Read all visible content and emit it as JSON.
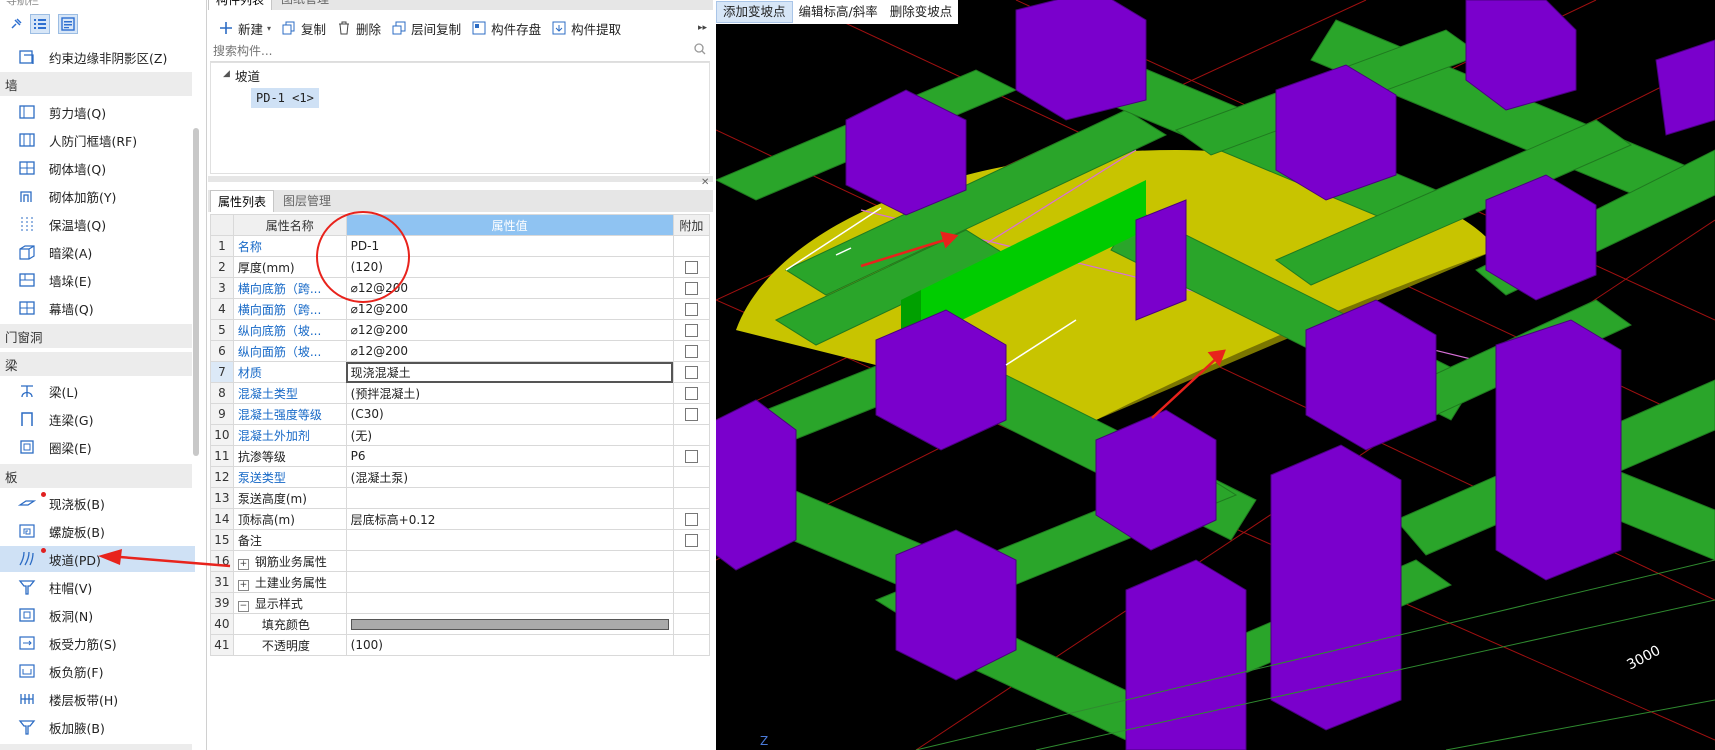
{
  "nav": {
    "title": "导航栏",
    "top_item": "约束边缘非阴影区(Z)",
    "categories": {
      "wall": "墙",
      "door_window": "门窗洞",
      "beam": "梁",
      "slab": "板"
    },
    "wall_items": [
      "剪力墙(Q)",
      "人防门框墙(RF)",
      "砌体墙(Q)",
      "砌体加筋(Y)",
      "保温墙(Q)",
      "暗梁(A)",
      "墙垛(E)",
      "幕墙(Q)"
    ],
    "beam_items": [
      "梁(L)",
      "连梁(G)",
      "圈梁(E)"
    ],
    "slab_items": [
      "现浇板(B)",
      "螺旋板(B)",
      "坡道(PD)",
      "柱帽(V)",
      "板洞(N)",
      "板受力筋(S)",
      "板负筋(F)",
      "楼层板带(H)",
      "板加腋(B)"
    ]
  },
  "component_list": {
    "tabs": [
      "构件列表",
      "图纸管理"
    ],
    "toolbar": {
      "new": "新建",
      "copy": "复制",
      "delete": "删除",
      "floor_copy": "层间复制",
      "save": "构件存盘",
      "extract": "构件提取"
    },
    "search_placeholder": "搜索构件...",
    "tree_root": "坡道",
    "tree_child": "PD-1 <1>"
  },
  "properties": {
    "tabs": [
      "属性列表",
      "图层管理"
    ],
    "headers": {
      "name": "属性名称",
      "value": "属性值",
      "extra": "附加"
    },
    "rows": [
      {
        "n": "1",
        "name": "名称",
        "value": "PD-1"
      },
      {
        "n": "2",
        "name": "厚度(mm)",
        "value": "(120)"
      },
      {
        "n": "3",
        "name": "横向底筋（跨...",
        "value": "⌀12@200"
      },
      {
        "n": "4",
        "name": "横向面筋（跨...",
        "value": "⌀12@200"
      },
      {
        "n": "5",
        "name": "纵向底筋（坡...",
        "value": "⌀12@200"
      },
      {
        "n": "6",
        "name": "纵向面筋（坡...",
        "value": "⌀12@200"
      },
      {
        "n": "7",
        "name": "材质",
        "value": "现浇混凝土"
      },
      {
        "n": "8",
        "name": "混凝土类型",
        "value": "(预拌混凝土)"
      },
      {
        "n": "9",
        "name": "混凝土强度等级",
        "value": "(C30)"
      },
      {
        "n": "10",
        "name": "混凝土外加剂",
        "value": "(无)"
      },
      {
        "n": "11",
        "name": "抗渗等级",
        "value": "P6"
      },
      {
        "n": "12",
        "name": "泵送类型",
        "value": "(混凝土泵)"
      },
      {
        "n": "13",
        "name": "泵送高度(m)",
        "value": ""
      },
      {
        "n": "14",
        "name": "顶标高(m)",
        "value": "层底标高+0.12"
      },
      {
        "n": "15",
        "name": "备注",
        "value": ""
      },
      {
        "n": "16",
        "name": "钢筋业务属性",
        "value": ""
      },
      {
        "n": "31",
        "name": "土建业务属性",
        "value": ""
      },
      {
        "n": "39",
        "name": "显示样式",
        "value": ""
      },
      {
        "n": "40",
        "name": "填充颜色",
        "value": ""
      },
      {
        "n": "41",
        "name": "不透明度",
        "value": "(100)"
      }
    ]
  },
  "viewport": {
    "toolbar": {
      "add_point": "添加变坡点",
      "edit_elev": "编辑标高/斜率",
      "delete_point": "删除变坡点"
    },
    "dimension_label": "3000",
    "axis_label": "Z"
  },
  "colors": {
    "beam": "#2aa52a",
    "column": "#7a00cc",
    "ramp_top": "#c8c400",
    "ramp_selected": "#00cc00",
    "annotation": "#e8231c"
  }
}
